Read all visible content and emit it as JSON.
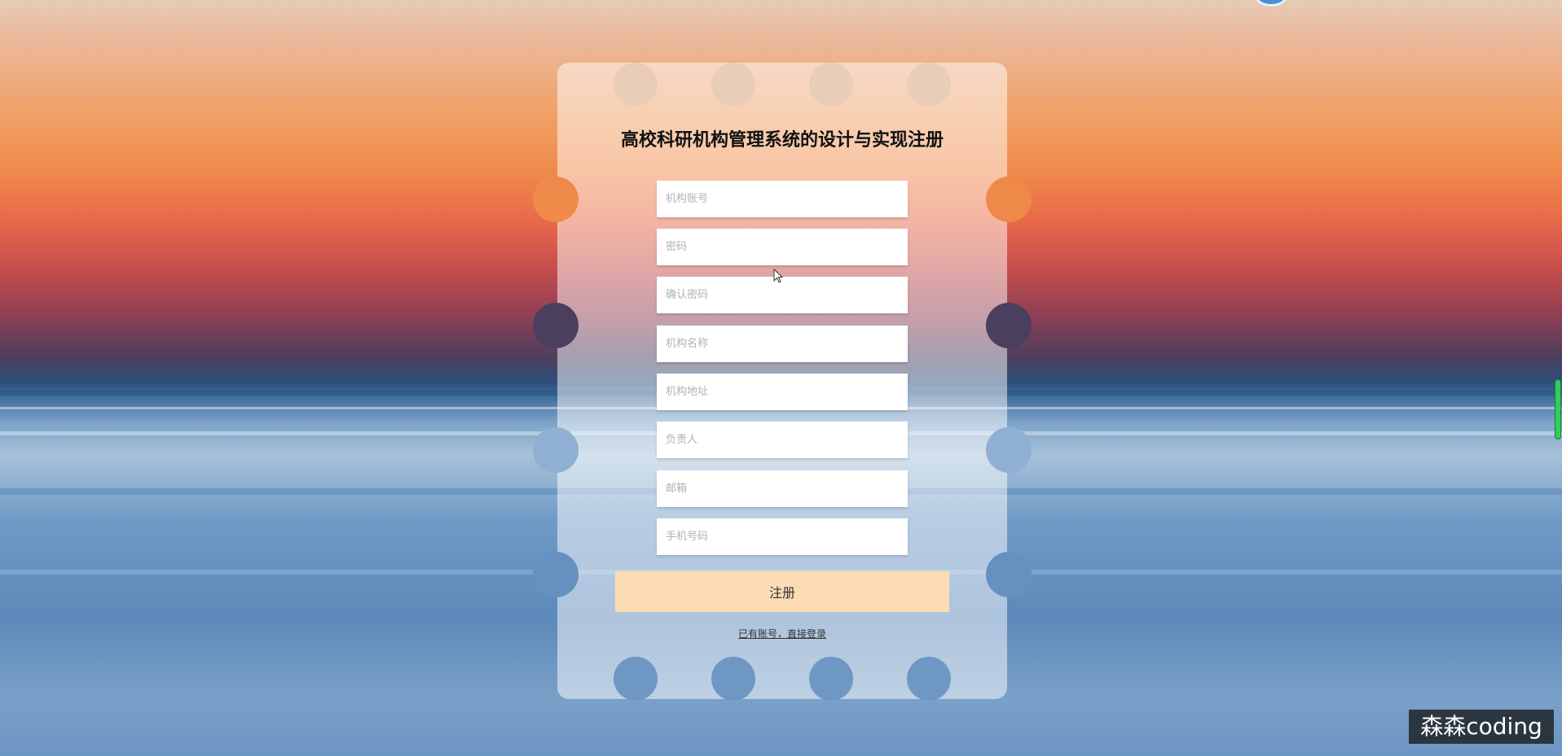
{
  "page": {
    "title": "高校科研机构管理系统的设计与实现注册"
  },
  "form": {
    "fields": [
      {
        "name": "account-field",
        "placeholder": "机构账号"
      },
      {
        "name": "password-field",
        "placeholder": "密码"
      },
      {
        "name": "confirm-password-field",
        "placeholder": "确认密码"
      },
      {
        "name": "org-name-field",
        "placeholder": "机构名称"
      },
      {
        "name": "org-address-field",
        "placeholder": "机构地址"
      },
      {
        "name": "contact-person-field",
        "placeholder": "负责人"
      },
      {
        "name": "email-field",
        "placeholder": "邮箱"
      },
      {
        "name": "phone-field",
        "placeholder": "手机号码"
      }
    ],
    "register_label": "注册",
    "login_link_label": "已有账号，直接登录"
  },
  "watermark": {
    "text": "森森coding"
  },
  "colors": {
    "register_button": "#fcdcb4",
    "ticket_overlay": "rgba(255,255,255,0.5)",
    "scroll_indicator": "#2fcf5a"
  },
  "icons": {
    "cursor": "arrow-cursor-icon",
    "top_orb": "circle-badge-icon"
  }
}
